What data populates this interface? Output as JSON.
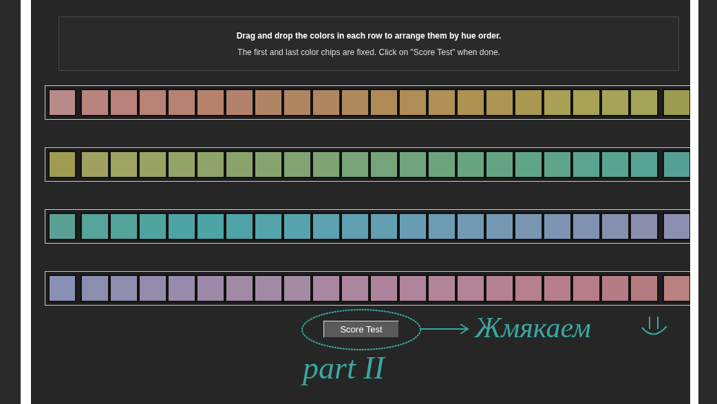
{
  "instructions": {
    "title": "Drag and drop the colors in each row to arrange them by hue order.",
    "subtitle": "The first and last color chips are fixed. Click on \"Score Test\" when done."
  },
  "rows": [
    {
      "chips": [
        {
          "kind": "fixed",
          "color": "#b98a87"
        },
        {
          "kind": "movable",
          "color": "#b9847e"
        },
        {
          "kind": "movable",
          "color": "#b8827a"
        },
        {
          "kind": "movable",
          "color": "#b88276"
        },
        {
          "kind": "movable",
          "color": "#b88272"
        },
        {
          "kind": "movable",
          "color": "#b6826c"
        },
        {
          "kind": "movable",
          "color": "#b4826a"
        },
        {
          "kind": "movable",
          "color": "#b28466"
        },
        {
          "kind": "movable",
          "color": "#b08562"
        },
        {
          "kind": "movable",
          "color": "#b08660"
        },
        {
          "kind": "movable",
          "color": "#b0885c"
        },
        {
          "kind": "movable",
          "color": "#b08a58"
        },
        {
          "kind": "movable",
          "color": "#b08c56"
        },
        {
          "kind": "movable",
          "color": "#b09054"
        },
        {
          "kind": "movable",
          "color": "#ae9252"
        },
        {
          "kind": "movable",
          "color": "#ac9452"
        },
        {
          "kind": "movable",
          "color": "#aa9852"
        },
        {
          "kind": "movable",
          "color": "#aaa055"
        },
        {
          "kind": "movable",
          "color": "#a8a255"
        },
        {
          "kind": "movable",
          "color": "#a6a456"
        },
        {
          "kind": "movable",
          "color": "#a4a456"
        },
        {
          "kind": "fixed",
          "color": "#9c9c50"
        }
      ]
    },
    {
      "chips": [
        {
          "kind": "fixed",
          "color": "#9e9c50"
        },
        {
          "kind": "movable",
          "color": "#a0a060"
        },
        {
          "kind": "movable",
          "color": "#9ea462"
        },
        {
          "kind": "movable",
          "color": "#98a464"
        },
        {
          "kind": "movable",
          "color": "#94a468"
        },
        {
          "kind": "movable",
          "color": "#8ea46a"
        },
        {
          "kind": "movable",
          "color": "#88a46c"
        },
        {
          "kind": "movable",
          "color": "#86a470"
        },
        {
          "kind": "movable",
          "color": "#82a472"
        },
        {
          "kind": "movable",
          "color": "#7ea474"
        },
        {
          "kind": "movable",
          "color": "#78a478"
        },
        {
          "kind": "movable",
          "color": "#74a47a"
        },
        {
          "kind": "movable",
          "color": "#70a47c"
        },
        {
          "kind": "movable",
          "color": "#6ca47e"
        },
        {
          "kind": "movable",
          "color": "#68a480"
        },
        {
          "kind": "movable",
          "color": "#64a484"
        },
        {
          "kind": "movable",
          "color": "#60a488"
        },
        {
          "kind": "movable",
          "color": "#5ea48a"
        },
        {
          "kind": "movable",
          "color": "#5aa490"
        },
        {
          "kind": "movable",
          "color": "#58a492"
        },
        {
          "kind": "movable",
          "color": "#56a494"
        },
        {
          "kind": "fixed",
          "color": "#54a096"
        }
      ]
    },
    {
      "chips": [
        {
          "kind": "fixed",
          "color": "#5aa094"
        },
        {
          "kind": "movable",
          "color": "#56a49a"
        },
        {
          "kind": "movable",
          "color": "#54a49c"
        },
        {
          "kind": "movable",
          "color": "#50a4a0"
        },
        {
          "kind": "movable",
          "color": "#4ea4a4"
        },
        {
          "kind": "movable",
          "color": "#4ca4a6"
        },
        {
          "kind": "movable",
          "color": "#50a4a8"
        },
        {
          "kind": "movable",
          "color": "#54a4aa"
        },
        {
          "kind": "movable",
          "color": "#58a4ae"
        },
        {
          "kind": "movable",
          "color": "#5ca2b0"
        },
        {
          "kind": "movable",
          "color": "#60a0b2"
        },
        {
          "kind": "movable",
          "color": "#649eb2"
        },
        {
          "kind": "movable",
          "color": "#689cb4"
        },
        {
          "kind": "movable",
          "color": "#6c9cb4"
        },
        {
          "kind": "movable",
          "color": "#709ab4"
        },
        {
          "kind": "movable",
          "color": "#7498b4"
        },
        {
          "kind": "movable",
          "color": "#7896b2"
        },
        {
          "kind": "movable",
          "color": "#7c94b2"
        },
        {
          "kind": "movable",
          "color": "#8092b0"
        },
        {
          "kind": "movable",
          "color": "#8490ae"
        },
        {
          "kind": "movable",
          "color": "#888eac"
        },
        {
          "kind": "fixed",
          "color": "#8c90b0"
        }
      ]
    },
    {
      "chips": [
        {
          "kind": "fixed",
          "color": "#8a90b4"
        },
        {
          "kind": "movable",
          "color": "#8c8eb0"
        },
        {
          "kind": "movable",
          "color": "#908cae"
        },
        {
          "kind": "movable",
          "color": "#948aac"
        },
        {
          "kind": "movable",
          "color": "#988aaa"
        },
        {
          "kind": "movable",
          "color": "#9c8aa8"
        },
        {
          "kind": "movable",
          "color": "#a08aa6"
        },
        {
          "kind": "movable",
          "color": "#a28aa4"
        },
        {
          "kind": "movable",
          "color": "#a48aa2"
        },
        {
          "kind": "movable",
          "color": "#a888a0"
        },
        {
          "kind": "movable",
          "color": "#ac869e"
        },
        {
          "kind": "movable",
          "color": "#ae849c"
        },
        {
          "kind": "movable",
          "color": "#b0849a"
        },
        {
          "kind": "movable",
          "color": "#b28498"
        },
        {
          "kind": "movable",
          "color": "#b48496"
        },
        {
          "kind": "movable",
          "color": "#b48292"
        },
        {
          "kind": "movable",
          "color": "#b6808e"
        },
        {
          "kind": "movable",
          "color": "#b67e8c"
        },
        {
          "kind": "movable",
          "color": "#b67e88"
        },
        {
          "kind": "movable",
          "color": "#b67c86"
        },
        {
          "kind": "movable",
          "color": "#b47c80"
        },
        {
          "kind": "fixed",
          "color": "#b8807e"
        }
      ]
    }
  ],
  "score_button": {
    "label": "Score Test"
  },
  "annotations": [
    {
      "text": "Жмякаем"
    },
    {
      "text": "part II"
    }
  ]
}
